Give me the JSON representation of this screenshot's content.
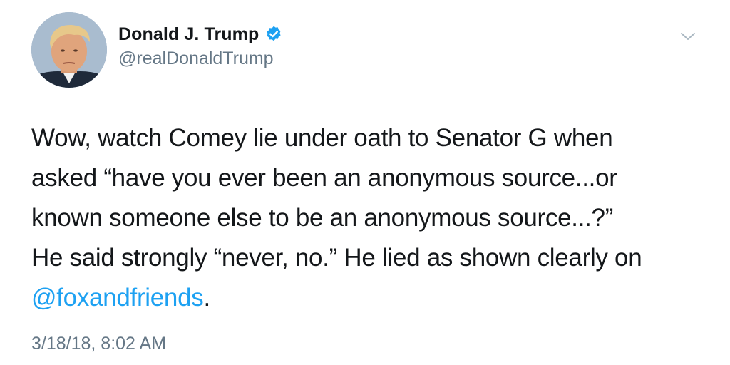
{
  "user": {
    "display_name": "Donald J. Trump",
    "handle": "@realDonaldTrump",
    "verified": true,
    "avatar_icon": "user-avatar"
  },
  "menu": {
    "icon": "chevron-down-icon"
  },
  "tweet": {
    "lines": [
      "Wow, watch Comey lie under oath to Senator G when",
      "asked “have you ever been an anonymous source...or",
      "known someone else to be an anonymous source...?”",
      "He said strongly “never, no.” He lied as shown clearly on"
    ],
    "mention": "@foxandfriends",
    "mention_suffix": ".",
    "timestamp": "3/18/18, 8:02 AM"
  },
  "colors": {
    "text": "#14171a",
    "secondary": "#657786",
    "link": "#1da1f2",
    "verified_badge": "#1da1f2"
  }
}
